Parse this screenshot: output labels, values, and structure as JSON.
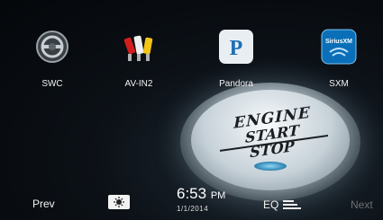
{
  "apps": [
    {
      "label": "SWC",
      "icon": "steering-wheel-icon"
    },
    {
      "label": "AV-IN2",
      "icon": "rca-cables-icon"
    },
    {
      "label": "Pandora",
      "icon": "pandora-icon",
      "glyph": "P"
    },
    {
      "label": "SXM",
      "icon": "siriusxm-icon",
      "glyph": "SiriusXM"
    }
  ],
  "engine_button": {
    "line1": "ENGINE",
    "line2": "START",
    "line3": "STOP"
  },
  "bottom": {
    "prev": "Prev",
    "next": "Next",
    "settings_icon": "brightness-icon",
    "time": "6:53",
    "ampm": "PM",
    "date": "1/1/2014",
    "eq": "EQ",
    "eq_icon": "equalizer-icon"
  },
  "colors": {
    "pandora_blue": "#1b6fb5",
    "sxm_blue": "#0a6fb8",
    "next_disabled": "#6b6f73"
  }
}
